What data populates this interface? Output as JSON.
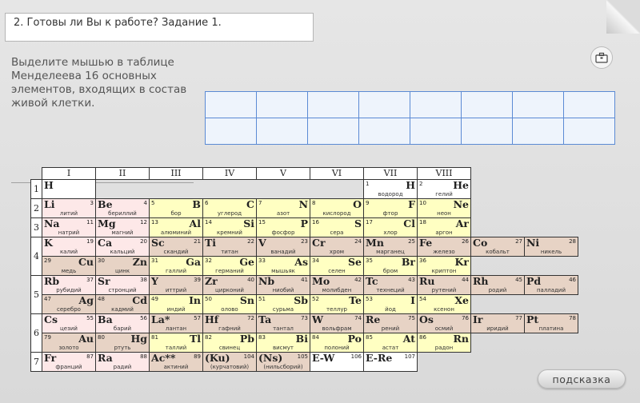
{
  "title": "2. Готовы ли Вы к работе? Задание 1.",
  "instruction": "Выделите мышью в таблице Менделеева 16 основных элементов, входящих в состав живой клетки.",
  "hint_button": "подсказка",
  "briefcase_icon": "briefcase-icon",
  "groups": [
    "I",
    "II",
    "III",
    "IV",
    "V",
    "VI",
    "VII",
    "VIII"
  ],
  "periods": [
    "1",
    "2",
    "3",
    "4",
    "5",
    "6",
    "7"
  ],
  "rows": [
    {
      "period": "1",
      "cells": [
        {
          "sym": "H",
          "num": "",
          "name": "",
          "align": "L",
          "color": "wht"
        },
        {
          "empty": true
        },
        {
          "empty": true
        },
        {
          "empty": true
        },
        {
          "empty": true
        },
        {
          "empty": true
        },
        {
          "sym": "H",
          "num": "1",
          "name": "водород",
          "align": "R",
          "color": "wht"
        },
        {
          "sym": "He",
          "num": "2",
          "name": "гелий",
          "align": "R",
          "color": "wht"
        },
        {
          "empty": true
        },
        {
          "empty": true
        }
      ]
    },
    {
      "period": "2",
      "cells": [
        {
          "sym": "Li",
          "num": "3",
          "name": "литий",
          "align": "L",
          "color": "pink"
        },
        {
          "sym": "Be",
          "num": "4",
          "name": "бериллий",
          "align": "L",
          "color": "pink"
        },
        {
          "sym": "B",
          "num": "5",
          "name": "бор",
          "align": "R",
          "color": "yel"
        },
        {
          "sym": "C",
          "num": "6",
          "name": "углерод",
          "align": "R",
          "color": "yel"
        },
        {
          "sym": "N",
          "num": "7",
          "name": "азот",
          "align": "R",
          "color": "yel"
        },
        {
          "sym": "O",
          "num": "8",
          "name": "кислород",
          "align": "R",
          "color": "yel"
        },
        {
          "sym": "F",
          "num": "9",
          "name": "фтор",
          "align": "R",
          "color": "yel"
        },
        {
          "sym": "Ne",
          "num": "10",
          "name": "неон",
          "align": "R",
          "color": "yel"
        },
        {
          "empty": true
        },
        {
          "empty": true
        }
      ]
    },
    {
      "period": "3",
      "cells": [
        {
          "sym": "Na",
          "num": "11",
          "name": "натрий",
          "align": "L",
          "color": "pink"
        },
        {
          "sym": "Mg",
          "num": "12",
          "name": "магний",
          "align": "L",
          "color": "pink"
        },
        {
          "sym": "Al",
          "num": "13",
          "name": "алюминий",
          "align": "R",
          "color": "yel"
        },
        {
          "sym": "Si",
          "num": "14",
          "name": "кремний",
          "align": "R",
          "color": "yel"
        },
        {
          "sym": "P",
          "num": "15",
          "name": "фосфор",
          "align": "R",
          "color": "yel"
        },
        {
          "sym": "S",
          "num": "16",
          "name": "сера",
          "align": "R",
          "color": "yel"
        },
        {
          "sym": "Cl",
          "num": "17",
          "name": "хлор",
          "align": "R",
          "color": "yel"
        },
        {
          "sym": "Ar",
          "num": "18",
          "name": "аргон",
          "align": "R",
          "color": "yel"
        },
        {
          "empty": true
        },
        {
          "empty": true
        }
      ]
    },
    {
      "period": "4",
      "cells": [
        {
          "sym": "K",
          "num": "19",
          "name": "калий",
          "align": "L",
          "color": "pink"
        },
        {
          "sym": "Ca",
          "num": "20",
          "name": "кальций",
          "align": "L",
          "color": "pink"
        },
        {
          "sym": "Sc",
          "num": "21",
          "name": "скандий",
          "align": "L",
          "color": "tan"
        },
        {
          "sym": "Ti",
          "num": "22",
          "name": "титан",
          "align": "L",
          "color": "tan"
        },
        {
          "sym": "V",
          "num": "23",
          "name": "ванадий",
          "align": "L",
          "color": "tan"
        },
        {
          "sym": "Cr",
          "num": "24",
          "name": "хром",
          "align": "L",
          "color": "tan"
        },
        {
          "sym": "Mn",
          "num": "25",
          "name": "марганец",
          "align": "L",
          "color": "tan"
        },
        {
          "sym": "Fe",
          "num": "26",
          "name": "железо",
          "align": "L",
          "color": "tan"
        },
        {
          "sym": "Co",
          "num": "27",
          "name": "кобальт",
          "align": "L",
          "color": "tan"
        },
        {
          "sym": "Ni",
          "num": "28",
          "name": "никель",
          "align": "L",
          "color": "tan"
        }
      ]
    },
    {
      "period": "4b",
      "cells": [
        {
          "sym": "Cu",
          "num": "29",
          "name": "медь",
          "align": "R",
          "color": "tan"
        },
        {
          "sym": "Zn",
          "num": "30",
          "name": "цинк",
          "align": "R",
          "color": "tan"
        },
        {
          "sym": "Ga",
          "num": "31",
          "name": "галлий",
          "align": "R",
          "color": "yel"
        },
        {
          "sym": "Ge",
          "num": "32",
          "name": "германий",
          "align": "R",
          "color": "yel"
        },
        {
          "sym": "As",
          "num": "33",
          "name": "мышьяк",
          "align": "R",
          "color": "yel"
        },
        {
          "sym": "Se",
          "num": "34",
          "name": "селен",
          "align": "R",
          "color": "yel"
        },
        {
          "sym": "Br",
          "num": "35",
          "name": "бром",
          "align": "R",
          "color": "yel"
        },
        {
          "sym": "Kr",
          "num": "36",
          "name": "криптон",
          "align": "R",
          "color": "yel"
        },
        {
          "empty": true
        },
        {
          "empty": true
        }
      ]
    },
    {
      "period": "5",
      "cells": [
        {
          "sym": "Rb",
          "num": "37",
          "name": "рубидий",
          "align": "L",
          "color": "pink"
        },
        {
          "sym": "Sr",
          "num": "38",
          "name": "стронций",
          "align": "L",
          "color": "pink"
        },
        {
          "sym": "Y",
          "num": "39",
          "name": "иттрий",
          "align": "L",
          "color": "tan"
        },
        {
          "sym": "Zr",
          "num": "40",
          "name": "цирконий",
          "align": "L",
          "color": "tan"
        },
        {
          "sym": "Nb",
          "num": "41",
          "name": "ниобий",
          "align": "L",
          "color": "tan"
        },
        {
          "sym": "Mo",
          "num": "42",
          "name": "молибден",
          "align": "L",
          "color": "tan"
        },
        {
          "sym": "Tc",
          "num": "43",
          "name": "технеций",
          "align": "L",
          "color": "tan"
        },
        {
          "sym": "Ru",
          "num": "44",
          "name": "рутений",
          "align": "L",
          "color": "tan"
        },
        {
          "sym": "Rh",
          "num": "45",
          "name": "родий",
          "align": "L",
          "color": "tan"
        },
        {
          "sym": "Pd",
          "num": "46",
          "name": "палладий",
          "align": "L",
          "color": "tan"
        }
      ]
    },
    {
      "period": "5b",
      "cells": [
        {
          "sym": "Ag",
          "num": "47",
          "name": "серебро",
          "align": "R",
          "color": "tan"
        },
        {
          "sym": "Cd",
          "num": "48",
          "name": "кадмий",
          "align": "R",
          "color": "tan"
        },
        {
          "sym": "In",
          "num": "49",
          "name": "индий",
          "align": "R",
          "color": "yel"
        },
        {
          "sym": "Sn",
          "num": "50",
          "name": "олово",
          "align": "R",
          "color": "yel"
        },
        {
          "sym": "Sb",
          "num": "51",
          "name": "сурьма",
          "align": "R",
          "color": "yel"
        },
        {
          "sym": "Te",
          "num": "52",
          "name": "теллур",
          "align": "R",
          "color": "yel"
        },
        {
          "sym": "I",
          "num": "53",
          "name": "йод",
          "align": "R",
          "color": "yel"
        },
        {
          "sym": "Xe",
          "num": "54",
          "name": "ксенон",
          "align": "R",
          "color": "yel"
        },
        {
          "empty": true
        },
        {
          "empty": true
        }
      ]
    },
    {
      "period": "6",
      "cells": [
        {
          "sym": "Cs",
          "num": "55",
          "name": "цезий",
          "align": "L",
          "color": "pink"
        },
        {
          "sym": "Ba",
          "num": "56",
          "name": "барий",
          "align": "L",
          "color": "pink"
        },
        {
          "sym": "La*",
          "num": "57",
          "name": "лантан",
          "align": "L",
          "color": "tan"
        },
        {
          "sym": "Hf",
          "num": "72",
          "name": "гафний",
          "align": "L",
          "color": "tan"
        },
        {
          "sym": "Ta",
          "num": "73",
          "name": "тантал",
          "align": "L",
          "color": "tan"
        },
        {
          "sym": "W",
          "num": "74",
          "name": "вольфрам",
          "align": "L",
          "color": "tan"
        },
        {
          "sym": "Re",
          "num": "75",
          "name": "рений",
          "align": "L",
          "color": "tan"
        },
        {
          "sym": "Os",
          "num": "76",
          "name": "осмий",
          "align": "L",
          "color": "tan"
        },
        {
          "sym": "Ir",
          "num": "77",
          "name": "иридий",
          "align": "L",
          "color": "tan"
        },
        {
          "sym": "Pt",
          "num": "78",
          "name": "платина",
          "align": "L",
          "color": "tan"
        }
      ]
    },
    {
      "period": "6b",
      "cells": [
        {
          "sym": "Au",
          "num": "79",
          "name": "золото",
          "align": "R",
          "color": "tan"
        },
        {
          "sym": "Hg",
          "num": "80",
          "name": "ртуть",
          "align": "R",
          "color": "tan"
        },
        {
          "sym": "Tl",
          "num": "81",
          "name": "таллий",
          "align": "R",
          "color": "yel"
        },
        {
          "sym": "Pb",
          "num": "82",
          "name": "свинец",
          "align": "R",
          "color": "yel"
        },
        {
          "sym": "Bi",
          "num": "83",
          "name": "висмут",
          "align": "R",
          "color": "yel"
        },
        {
          "sym": "Po",
          "num": "84",
          "name": "полоний",
          "align": "R",
          "color": "yel"
        },
        {
          "sym": "At",
          "num": "85",
          "name": "астат",
          "align": "R",
          "color": "yel"
        },
        {
          "sym": "Rn",
          "num": "86",
          "name": "радон",
          "align": "R",
          "color": "yel"
        },
        {
          "empty": true
        },
        {
          "empty": true
        }
      ]
    },
    {
      "period": "7",
      "cells": [
        {
          "sym": "Fr",
          "num": "87",
          "name": "франций",
          "align": "L",
          "color": "pink"
        },
        {
          "sym": "Ra",
          "num": "88",
          "name": "радий",
          "align": "L",
          "color": "pink"
        },
        {
          "sym": "Ac**",
          "num": "89",
          "name": "актиний",
          "align": "L",
          "color": "tan"
        },
        {
          "sym": "(Ku)",
          "num": "104",
          "name": "(курчатовий)",
          "align": "L",
          "color": "tan"
        },
        {
          "sym": "(Ns)",
          "num": "105",
          "name": "(нильсборий)",
          "align": "L",
          "color": "tan"
        },
        {
          "sym": "E-W",
          "num": "106",
          "name": "",
          "align": "L",
          "color": "wht"
        },
        {
          "sym": "E-Re",
          "num": "107",
          "name": "",
          "align": "L",
          "color": "wht"
        },
        {
          "empty": true
        },
        {
          "empty": true
        },
        {
          "empty": true
        }
      ]
    }
  ]
}
